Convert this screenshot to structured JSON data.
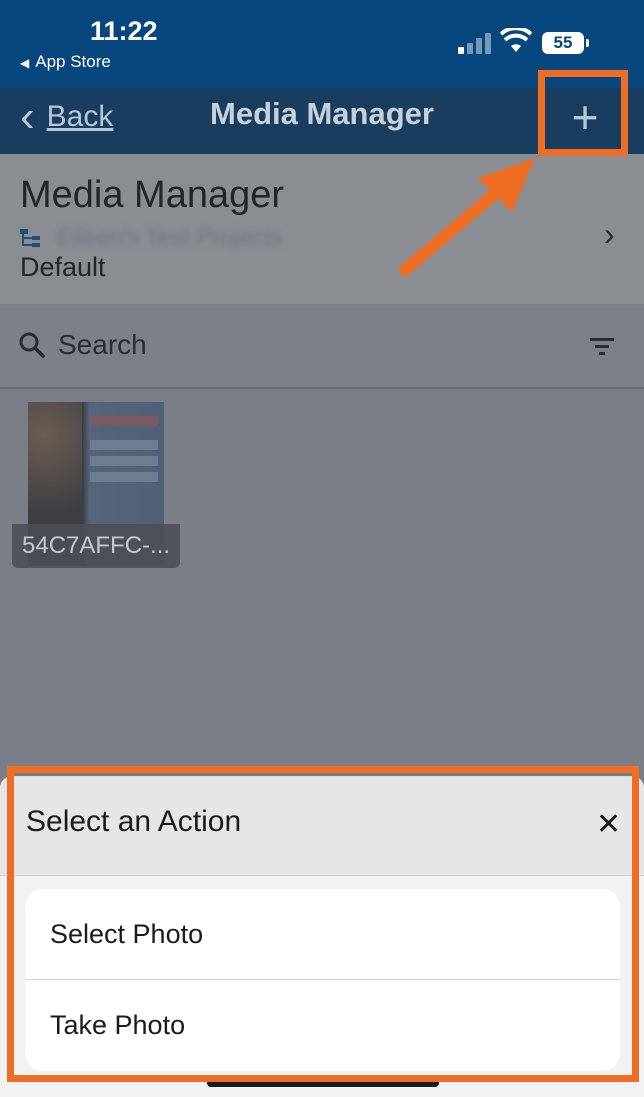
{
  "status_bar": {
    "time": "11:22",
    "back_app": "App Store",
    "battery": "55",
    "back_arrow_icon": "triangle-left-icon",
    "signal_icon": "cellular-signal-icon",
    "wifi_icon": "wifi-icon"
  },
  "nav": {
    "back_label": "Back",
    "back_icon": "chevron-left-icon",
    "title": "Media Manager",
    "add_icon": "plus-icon"
  },
  "header": {
    "title": "Media Manager",
    "project_name": "Eileen's Test Projects",
    "project_icon": "hierarchy-icon",
    "subtitle": "Default",
    "chevron_icon": "chevron-right-icon"
  },
  "search": {
    "placeholder": "Search",
    "search_icon": "search-icon",
    "filter_icon": "filter-icon"
  },
  "media_items": [
    {
      "caption": "54C7AFFC-..."
    }
  ],
  "action_sheet": {
    "title": "Select an Action",
    "close_icon": "close-icon",
    "options": [
      "Select Photo",
      "Take Photo"
    ]
  },
  "colors": {
    "status_bar_bg": "#07477d",
    "nav_bg": "#193d5e",
    "overlay": "#7a7e86",
    "highlight": "#ef6e23"
  }
}
